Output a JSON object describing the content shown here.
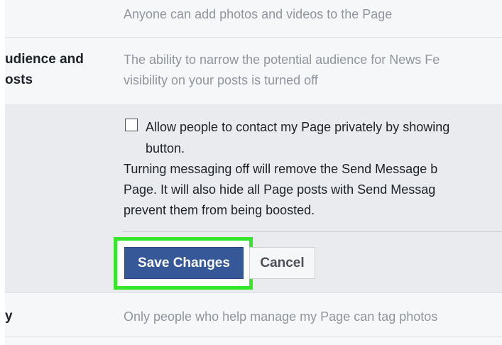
{
  "rows": {
    "visitor_posts": {
      "description": "Anyone can add photos and videos to the Page"
    },
    "audience": {
      "label_line1": "udience and",
      "label_line2": "osts",
      "description_line1": "The ability to narrow the potential audience for News Fe",
      "description_line2": "visibility on your posts is turned off"
    },
    "tagging": {
      "label": "y",
      "description": "Only people who help manage my Page can tag photos"
    }
  },
  "messages": {
    "checkbox_checked": false,
    "checkbox_label_line1": "Allow people to contact my Page privately by showing",
    "checkbox_label_line2": "button.",
    "help_line1": "Turning messaging off will remove the Send Message b",
    "help_line2": "Page. It will also hide all Page posts with Send Messag",
    "help_line3": "prevent them from being boosted."
  },
  "buttons": {
    "save_label": "Save Changes",
    "cancel_label": "Cancel"
  },
  "colors": {
    "primary_button": "#365899",
    "highlight": "#35e629",
    "panel_background": "#e9ebee",
    "row_background": "#f6f7f9"
  }
}
